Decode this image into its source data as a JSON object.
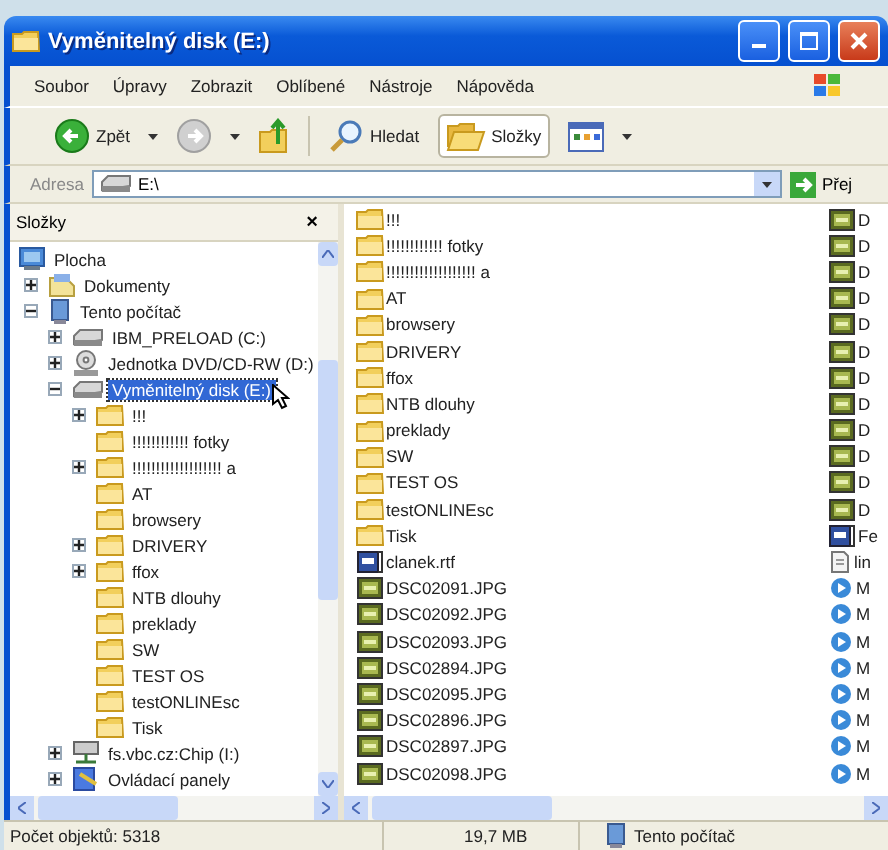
{
  "window": {
    "title": "Vyměnitelný disk (E:)"
  },
  "menu": [
    "Soubor",
    "Úpravy",
    "Zobrazit",
    "Oblíbené",
    "Nástroje",
    "Nápověda"
  ],
  "toolbar": [
    {
      "kind": "back",
      "label": "Zpět",
      "selected": false
    },
    {
      "kind": "forward",
      "selected": false
    },
    {
      "kind": "up",
      "selected": false
    },
    {
      "kind": "search",
      "label": "Hledat",
      "selected": false
    },
    {
      "kind": "folders",
      "label": "Složky",
      "selected": true
    },
    {
      "kind": "views",
      "selected": false
    }
  ],
  "address": {
    "label": "Adresa",
    "value": "E:\\",
    "go": "Přej"
  },
  "folders_pane": {
    "title": "Složky",
    "close": "×",
    "tree": [
      {
        "label": "Plocha",
        "kind": "desktop",
        "selected": false,
        "children": [
          {
            "label": "Dokumenty",
            "kind": "documents",
            "expanded": false,
            "selected": false
          },
          {
            "label": "Tento počítač",
            "kind": "computer",
            "expanded": true,
            "selected": false,
            "children": [
              {
                "label": "IBM_PRELOAD (C:)",
                "kind": "drive",
                "expanded": false,
                "selected": false
              },
              {
                "label": "Jednotka DVD/CD-RW (D:)",
                "kind": "dvd",
                "expanded": false,
                "selected": false
              },
              {
                "label": "Vyměnitelný disk (E:)",
                "kind": "drive",
                "expanded": true,
                "selected": true,
                "children": [
                  {
                    "label": "!!!",
                    "kind": "folder",
                    "expanded": false,
                    "selected": false
                  },
                  {
                    "label": "!!!!!!!!!!!! fotky",
                    "kind": "folder",
                    "selected": false
                  },
                  {
                    "label": "!!!!!!!!!!!!!!!!!!! a",
                    "kind": "folder",
                    "expanded": false,
                    "selected": false
                  },
                  {
                    "label": "AT",
                    "kind": "folder",
                    "selected": false
                  },
                  {
                    "label": "browsery",
                    "kind": "folder",
                    "selected": false
                  },
                  {
                    "label": "DRIVERY",
                    "kind": "folder",
                    "expanded": false,
                    "selected": false
                  },
                  {
                    "label": "ffox",
                    "kind": "folder",
                    "expanded": false,
                    "selected": false
                  },
                  {
                    "label": "NTB dlouhy",
                    "kind": "folder",
                    "selected": false
                  },
                  {
                    "label": "preklady",
                    "kind": "folder",
                    "selected": false
                  },
                  {
                    "label": "SW",
                    "kind": "folder",
                    "selected": false
                  },
                  {
                    "label": "TEST OS",
                    "kind": "folder",
                    "selected": false
                  },
                  {
                    "label": "testONLINEsc",
                    "kind": "folder",
                    "selected": false
                  },
                  {
                    "label": "Tisk",
                    "kind": "folder",
                    "selected": false
                  }
                ]
              },
              {
                "label": "fs.vbc.cz:Chip (I:)",
                "kind": "netdrive",
                "expanded": false,
                "selected": false
              },
              {
                "label": "Ovládací panely",
                "kind": "controlpanel",
                "expanded": false,
                "selected": false
              }
            ]
          }
        ]
      }
    ]
  },
  "files": {
    "column_1": [
      {
        "name": "!!!",
        "kind": "folder"
      },
      {
        "name": "!!!!!!!!!!!! fotky",
        "kind": "folder"
      },
      {
        "name": "!!!!!!!!!!!!!!!!!!! a",
        "kind": "folder"
      },
      {
        "name": "AT",
        "kind": "folder"
      },
      {
        "name": "browsery",
        "kind": "folder"
      },
      {
        "name": "DRIVERY",
        "kind": "folder"
      },
      {
        "name": "ffox",
        "kind": "folder"
      },
      {
        "name": "NTB dlouhy",
        "kind": "folder"
      },
      {
        "name": "preklady",
        "kind": "folder"
      },
      {
        "name": "SW",
        "kind": "folder"
      },
      {
        "name": "TEST OS",
        "kind": "folder"
      },
      {
        "name": "testONLINEsc",
        "kind": "folder"
      },
      {
        "name": "Tisk",
        "kind": "folder"
      },
      {
        "name": "clanek.rtf",
        "kind": "rtf"
      },
      {
        "name": "DSC02091.JPG",
        "kind": "jpg"
      },
      {
        "name": "DSC02092.JPG",
        "kind": "jpg"
      },
      {
        "name": "DSC02093.JPG",
        "kind": "jpg"
      },
      {
        "name": "DSC02894.JPG",
        "kind": "jpg"
      },
      {
        "name": "DSC02095.JPG",
        "kind": "jpg"
      },
      {
        "name": "DSC02896.JPG",
        "kind": "jpg"
      },
      {
        "name": "DSC02897.JPG",
        "kind": "jpg"
      },
      {
        "name": "DSC02098.JPG",
        "kind": "jpg"
      }
    ],
    "column_2": [
      {
        "name": "D",
        "kind": "jpg"
      },
      {
        "name": "D",
        "kind": "jpg"
      },
      {
        "name": "D",
        "kind": "jpg"
      },
      {
        "name": "D",
        "kind": "jpg"
      },
      {
        "name": "D",
        "kind": "jpg"
      },
      {
        "name": "D",
        "kind": "jpg"
      },
      {
        "name": "D",
        "kind": "jpg"
      },
      {
        "name": "D",
        "kind": "jpg"
      },
      {
        "name": "D",
        "kind": "jpg"
      },
      {
        "name": "D",
        "kind": "jpg"
      },
      {
        "name": "D",
        "kind": "jpg"
      },
      {
        "name": "D",
        "kind": "jpg"
      },
      {
        "name": "Fe",
        "kind": "rtf"
      },
      {
        "name": "lin",
        "kind": "text"
      },
      {
        "name": "M",
        "kind": "media"
      },
      {
        "name": "M",
        "kind": "media"
      },
      {
        "name": "M",
        "kind": "media"
      },
      {
        "name": "M",
        "kind": "media"
      },
      {
        "name": "M",
        "kind": "media"
      },
      {
        "name": "M",
        "kind": "media"
      },
      {
        "name": "M",
        "kind": "media"
      },
      {
        "name": "M",
        "kind": "media"
      }
    ]
  },
  "status_bar": {
    "objects": "Počet objektů: 5318",
    "size": "19,7 MB",
    "zone": "Tento počítač"
  }
}
